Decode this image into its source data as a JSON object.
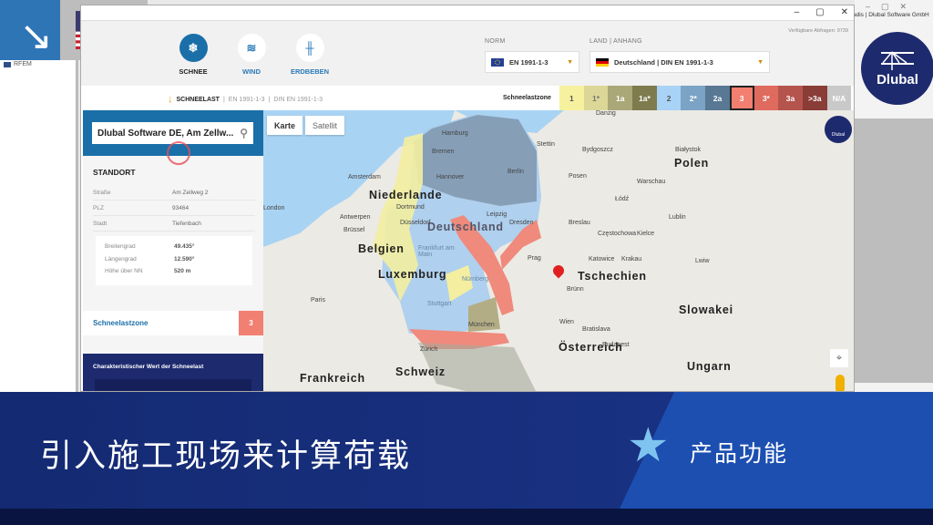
{
  "overlay": {
    "arrow_icon": "arrow-down-right",
    "flag": "us-flag"
  },
  "host": {
    "sidebar_item": "RFEM",
    "title_text": "adis | Dlubal Software GmbH",
    "logo_text": "Dlubal"
  },
  "app": {
    "tools": [
      {
        "label": "SCHNEE",
        "icon": "snowflake",
        "active": true
      },
      {
        "label": "WIND",
        "icon": "wind"
      },
      {
        "label": "ERDBEBEN",
        "icon": "seismic-wave"
      }
    ],
    "norm_label": "NORM",
    "norm_value": "EN 1991-1-3",
    "land_label": "LAND | ANHANG",
    "land_value": "Deutschland | DIN EN 1991-1-3",
    "available": "Verfügbare Abfragen: 9739",
    "breadcrumb": {
      "main": "SCHNEELAST",
      "sep1": "|",
      "part2": "EN 1991-1-3",
      "sep2": "|",
      "part3": "DIN EN 1991-1-3"
    },
    "zone_label": "Schneelastzone",
    "zones": [
      {
        "label": "1",
        "color": "#f6f19e",
        "text": "#555"
      },
      {
        "label": "1*",
        "color": "#dcd796",
        "text": "#777"
      },
      {
        "label": "1a",
        "color": "#aaa878",
        "text": "#fff"
      },
      {
        "label": "1a*",
        "color": "#7e7c4e",
        "text": "#fff"
      },
      {
        "label": "2",
        "color": "#a9d2f7",
        "text": "#555"
      },
      {
        "label": "2*",
        "color": "#7aa3c6",
        "text": "#fff"
      },
      {
        "label": "2a",
        "color": "#587894",
        "text": "#fff"
      },
      {
        "label": "3",
        "color": "#f27f70",
        "text": "#fff",
        "selected": true
      },
      {
        "label": "3*",
        "color": "#df6a5e",
        "text": "#fff"
      },
      {
        "label": "3a",
        "color": "#b5544c",
        "text": "#fff"
      },
      {
        "label": ">3a",
        "color": "#8a3c37",
        "text": "#fff"
      },
      {
        "label": "N/A",
        "color": "#c9c9c9",
        "text": "#fff"
      }
    ]
  },
  "panel": {
    "search_value": "Dlubal Software DE, Am Zellw...",
    "standort_title": "STANDORT",
    "fields": [
      {
        "k": "Straße",
        "v": "Am Zellweg 2"
      },
      {
        "k": "PLZ",
        "v": "93464"
      },
      {
        "k": "Stadt",
        "v": "Tiefenbach"
      }
    ],
    "coords": [
      {
        "k": "Breitengrad",
        "v": "49.435°"
      },
      {
        "k": "Längengrad",
        "v": "12.590°"
      },
      {
        "k": "Höhe über NN",
        "v": "520 m"
      }
    ],
    "zone_title": "Schneelastzone",
    "zone_value": "3",
    "char_title": "Charakteristischer Wert der Schneelast"
  },
  "map": {
    "tab_map": "Karte",
    "tab_sat": "Satellit",
    "logo": "Dlubal",
    "countries": [
      "Niederlande",
      "Deutschland",
      "Belgien",
      "Luxemburg",
      "Tschechien",
      "Polen",
      "Slowakei",
      "Österreich",
      "Ungarn",
      "Schweiz",
      "Frankreich"
    ],
    "cities": [
      "Danzig",
      "Stettin",
      "Bydgoszcz",
      "Hamburg",
      "Bremen",
      "Berlin",
      "Amsterdam",
      "Posen",
      "Warschau",
      "Łódź",
      "Hannover",
      "London",
      "Leipzig",
      "Dortmund",
      "Lublin",
      "Antwerpen",
      "Brüssel",
      "Dresden",
      "Breslau",
      "Częstochowa",
      "Frankfurt am Main",
      "Prag",
      "Katowice",
      "Krakau",
      "Paris",
      "Nürnberg",
      "Stuttgart",
      "Brünn",
      "Wien",
      "Bratislava",
      "München",
      "Zürich",
      "Budapest",
      "Białystok",
      "Lwiw",
      "Kielce",
      "Düsseldorf"
    ]
  },
  "banner": {
    "title": "引入施工现场来计算荷载",
    "subtitle": "产品功能"
  }
}
